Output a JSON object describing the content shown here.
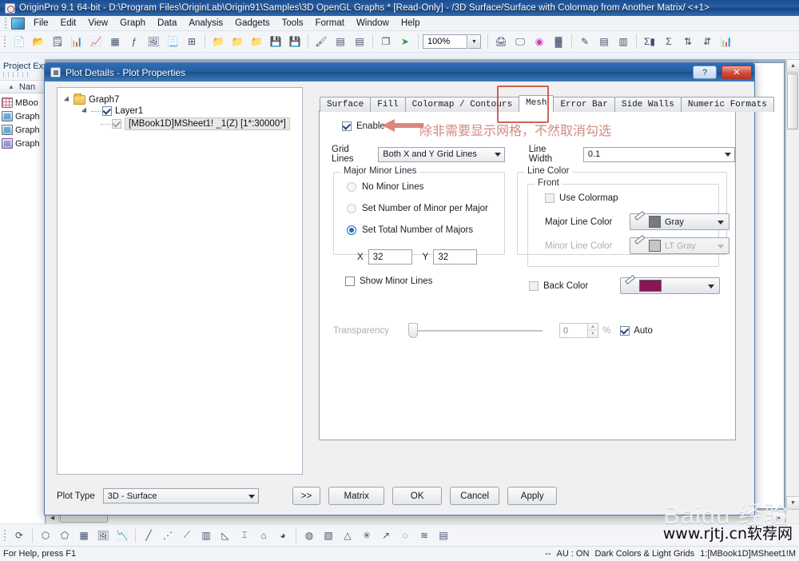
{
  "window": {
    "title": "OriginPro 9.1 64-bit - D:\\Program Files\\OriginLab\\Origin91\\Samples\\3D OpenGL Graphs * [Read-Only] - /3D Surface/Surface with Colormap from Another Matrix/ <+1>",
    "app_icon": "origin-icon"
  },
  "menubar": {
    "items": [
      {
        "label": "File"
      },
      {
        "label": "Edit"
      },
      {
        "label": "View"
      },
      {
        "label": "Graph"
      },
      {
        "label": "Data"
      },
      {
        "label": "Analysis"
      },
      {
        "label": "Gadgets"
      },
      {
        "label": "Tools"
      },
      {
        "label": "Format"
      },
      {
        "label": "Window"
      },
      {
        "label": "Help"
      }
    ]
  },
  "toolbar": {
    "zoom_value": "100%",
    "buttons": [
      {
        "name": "new-project-icon",
        "glyph": "□"
      },
      {
        "name": "open-folder-icon",
        "glyph": "□"
      },
      {
        "name": "new-workbook-icon",
        "glyph": "▦"
      },
      {
        "name": "new-excel-icon",
        "glyph": "▦"
      },
      {
        "name": "new-graph-icon",
        "glyph": "▧"
      },
      {
        "name": "new-matrix-icon",
        "glyph": "▦"
      },
      {
        "name": "new-function-plot-icon",
        "glyph": "f"
      },
      {
        "name": "new-layout-icon",
        "glyph": "▣"
      },
      {
        "name": "new-notes-icon",
        "glyph": "▤"
      },
      {
        "name": "add-new-icon",
        "glyph": "⊞"
      },
      {
        "name": "open-icon",
        "glyph": "▱"
      },
      {
        "name": "open-excel-icon",
        "glyph": "▱"
      },
      {
        "name": "append-project-icon",
        "glyph": "▱"
      },
      {
        "name": "save-project-icon",
        "glyph": "■"
      },
      {
        "name": "save-template-icon",
        "glyph": "■"
      },
      {
        "name": "save-window-icon",
        "glyph": "■"
      },
      {
        "name": "import-wizard-icon",
        "glyph": "✇"
      },
      {
        "name": "import-single-ascii-icon",
        "glyph": "≡"
      },
      {
        "name": "import-multiple-ascii-icon",
        "glyph": "≡"
      },
      {
        "name": "copy-icon",
        "glyph": "❐"
      },
      {
        "name": "run-script-icon",
        "glyph": "➤"
      }
    ],
    "right_buttons": [
      {
        "name": "print-icon",
        "glyph": "⎙"
      },
      {
        "name": "presentation-icon",
        "glyph": "▣"
      },
      {
        "name": "duplicate-icon",
        "glyph": "◎"
      },
      {
        "name": "film-icon",
        "glyph": "▓"
      },
      {
        "name": "annotate-icon",
        "glyph": "✎"
      },
      {
        "name": "tile-horizontal-icon",
        "glyph": "≡"
      },
      {
        "name": "tile-vertical-icon",
        "glyph": "‖"
      },
      {
        "name": "sigma-icon",
        "glyph": "Σ"
      },
      {
        "name": "statistics-icon",
        "glyph": "Σ"
      },
      {
        "name": "sort-icon",
        "glyph": "⇅"
      },
      {
        "name": "numeric-icon",
        "glyph": "↓"
      },
      {
        "name": "chart-icon",
        "glyph": "ᵟ"
      }
    ]
  },
  "project_explorer": {
    "title": "Project Exp",
    "column_header": "Nan",
    "items": [
      {
        "label": "MBoo",
        "icon": "matrix-book-icon"
      },
      {
        "label": "Graph",
        "icon": "graph-window-icon"
      },
      {
        "label": "Graph",
        "icon": "graph-window-icon"
      },
      {
        "label": "Graph",
        "icon": "graph-window-violet-icon"
      }
    ]
  },
  "dialog": {
    "title": "Plot Details - Plot Properties",
    "help_button": "?",
    "close_button": "✕",
    "tree": {
      "root": "Graph7",
      "layer": "Layer1",
      "dataset": "[MBook1D]MSheet1! _1(Z) [1*:30000*]"
    },
    "tabs": [
      {
        "label": "Surface",
        "active": false
      },
      {
        "label": "Fill",
        "active": false
      },
      {
        "label": "Colormap / Contours",
        "active": false
      },
      {
        "label": "Mesh",
        "active": true
      },
      {
        "label": "Error Bar",
        "active": false
      },
      {
        "label": "Side Walls",
        "active": false
      },
      {
        "label": "Numeric Formats",
        "active": false
      }
    ],
    "mesh": {
      "enable_label": "Enable",
      "enable_checked": true,
      "grid_lines_label": "Grid Lines",
      "grid_lines_value": "Both X and Y Grid Lines",
      "line_width_label": "Line Width",
      "line_width_value": "0.1",
      "major_minor": {
        "group_title": "Major Minor Lines",
        "option_no_minor": "No Minor Lines",
        "option_number_minor": "Set Number of Minor per Major",
        "option_total_majors": "Set Total Number of Majors",
        "selected": "Set Total Number of Majors",
        "x_label": "X",
        "x_value": "32",
        "y_label": "Y",
        "y_value": "32",
        "show_minor_lines_label": "Show Minor Lines",
        "show_minor_lines_checked": false
      },
      "line_color": {
        "group_title": "Line Color",
        "front_title": "Front",
        "use_colormap_label": "Use Colormap",
        "use_colormap_checked": false,
        "major_line_color_label": "Major Line Color",
        "major_line_color_value": "Gray",
        "major_line_color_hex": "#7a7a7a",
        "minor_line_color_label": "Minor Line Color",
        "minor_line_color_value": "LT Gray",
        "minor_line_color_hex": "#c6c6c6",
        "back_color_label": "Back Color",
        "back_color_checked": false,
        "back_color_hex": "#8b1453"
      },
      "transparency": {
        "label": "Transparency",
        "value": "0",
        "unit": "%",
        "auto_label": "Auto",
        "auto_checked": true
      }
    },
    "footer": {
      "plot_type_label": "Plot Type",
      "plot_type_value": "3D - Surface",
      "expand_button": ">>",
      "matrix_button": "Matrix",
      "ok_button": "OK",
      "cancel_button": "Cancel",
      "apply_button": "Apply"
    }
  },
  "annotations": {
    "chinese_note": "除非需要显示网格，不然取消勾选",
    "highlight_color": "#c0392b"
  },
  "statusbar": {
    "left": "For Help, press F1",
    "right_sep": "--",
    "au": "AU : ON",
    "theme": "Dark Colors & Light Grids",
    "dataset": "1:[MBook1D]MSheet1!M"
  },
  "watermark": {
    "baidu": "Baidu 经验",
    "site": "www.rjtj.cn软荐网"
  }
}
